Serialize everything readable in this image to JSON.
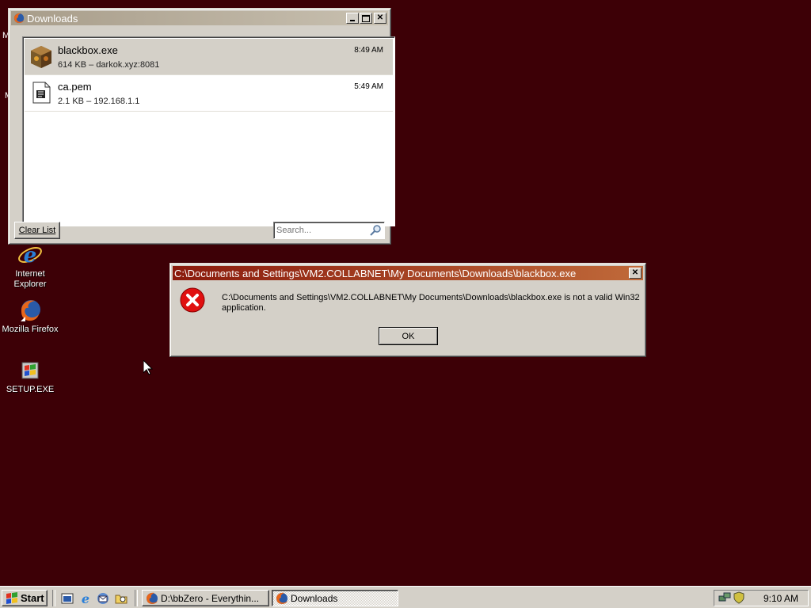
{
  "desktop": {
    "background_color": "#3d0006",
    "icons": [
      {
        "label": "Internet Explorer",
        "icon": "internet-explorer-icon"
      },
      {
        "label": "Mozilla Firefox",
        "icon": "firefox-icon"
      },
      {
        "label": "SETUP.EXE",
        "icon": "windows-setup-icon"
      }
    ],
    "partial_labels": [
      "M",
      "M"
    ]
  },
  "downloads_window": {
    "title": "Downloads",
    "items": [
      {
        "name": "blackbox.exe",
        "meta": "614 KB – darkok.xyz:8081",
        "time": "8:49 AM",
        "icon": "exe-box-icon",
        "selected": true
      },
      {
        "name": "ca.pem",
        "meta": "2.1 KB – 192.168.1.1",
        "time": "5:49 AM",
        "icon": "document-icon",
        "selected": false
      }
    ],
    "clear_list_label": "Clear List",
    "search_placeholder": "Search..."
  },
  "error_dialog": {
    "title": "C:\\Documents and Settings\\VM2.COLLABNET\\My Documents\\Downloads\\blackbox.exe",
    "message": "C:\\Documents and Settings\\VM2.COLLABNET\\My Documents\\Downloads\\blackbox.exe is not a valid Win32 application.",
    "ok_label": "OK",
    "icon": "error-icon"
  },
  "taskbar": {
    "start_label": "Start",
    "quick_launch": [
      "show-desktop-icon",
      "internet-explorer-icon",
      "outlook-express-icon",
      "explorer-icon"
    ],
    "buttons": [
      {
        "label": "D:\\bbZero - Everythin...",
        "icon": "firefox-icon",
        "active": false
      },
      {
        "label": "Downloads",
        "icon": "firefox-icon",
        "active": true
      }
    ],
    "clock": "9:10 AM"
  }
}
